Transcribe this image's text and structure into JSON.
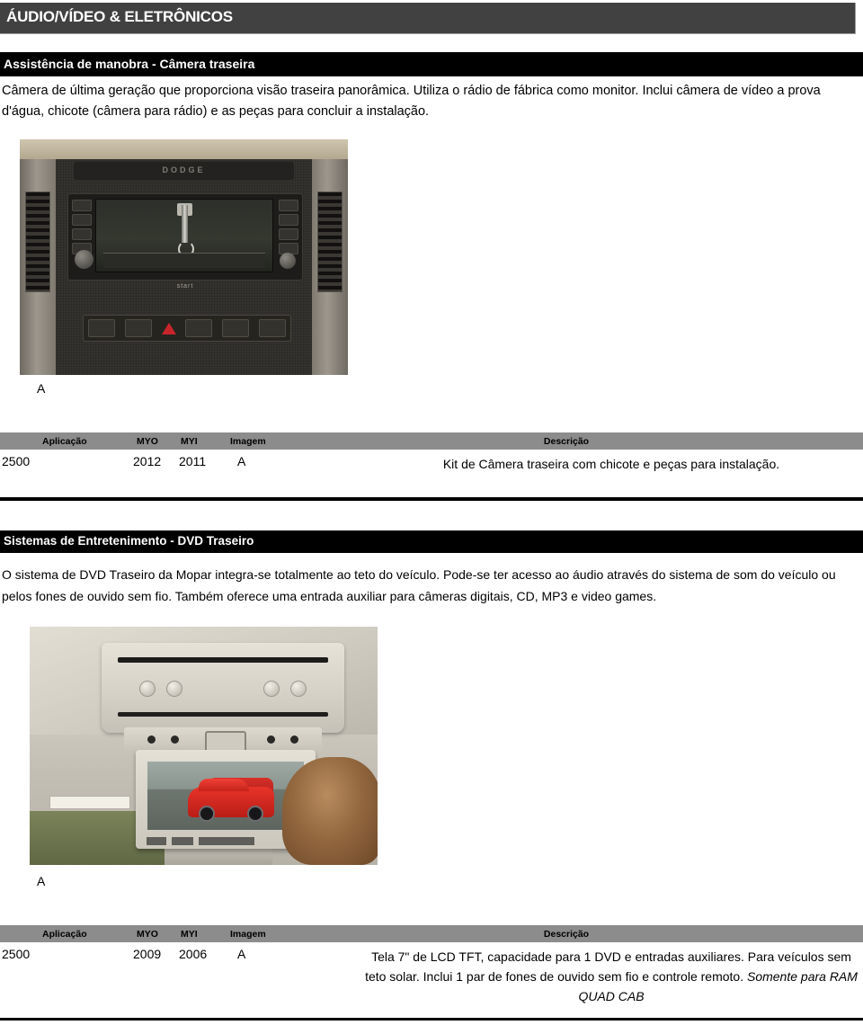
{
  "category": {
    "title": "ÁUDIO/VÍDEO & ELETRÔNICOS"
  },
  "sections": [
    {
      "id": "rear-camera",
      "title": "Assistência de manobra - Câmera traseira",
      "description": "Câmera de última geração que proporciona visão traseira panorâmica. Utiliza o rádio de fábrica como monitor. Inclui câmera de vídeo a prova d'água, chicote (câmera para rádio) e as peças para concluir a instalação.",
      "photo_caption": "A",
      "table": {
        "headers": {
          "aplicacao": "Aplicação",
          "myo": "MYO",
          "myi": "MYI",
          "imagem": "Imagem",
          "descricao": "Descrição"
        },
        "rows": [
          {
            "aplicacao": "2500",
            "myo": "2012",
            "myi": "2011",
            "imagem": "A",
            "descricao": "Kit de Câmera traseira com chicote e peças para instalação.",
            "descricao_italic": ""
          }
        ]
      }
    },
    {
      "id": "rear-dvd",
      "title": "Sistemas de Entretenimento - DVD Traseiro",
      "description": "O sistema de DVD Traseiro da Mopar integra-se totalmente ao teto do veículo. Pode-se ter acesso ao áudio através do sistema de som do veículo ou pelos fones de ouvido sem fio. Também oferece uma entrada auxiliar para câmeras digitais, CD, MP3 e video games.",
      "photo_caption": "A",
      "table": {
        "headers": {
          "aplicacao": "Aplicação",
          "myo": "MYO",
          "myi": "MYI",
          "imagem": "Imagem",
          "descricao": "Descrição"
        },
        "rows": [
          {
            "aplicacao": "2500",
            "myo": "2009",
            "myi": "2006",
            "imagem": "A",
            "descricao": "Tela 7\" de LCD TFT, capacidade para 1 DVD e entradas auxiliares. Para veículos sem teto solar. Inclui 1 par de fones de ouvido sem fio e controle remoto. ",
            "descricao_italic": "Somente para RAM QUAD CAB"
          }
        ]
      }
    }
  ],
  "photo_alt": {
    "dashboard_brand": "DODGE",
    "radio_brand": "start"
  },
  "colors": {
    "category_banner": "#414141",
    "section_bar": "#000000",
    "table_header": "#8c8c8c",
    "text": "#000000",
    "page_background": "#ffffff"
  }
}
